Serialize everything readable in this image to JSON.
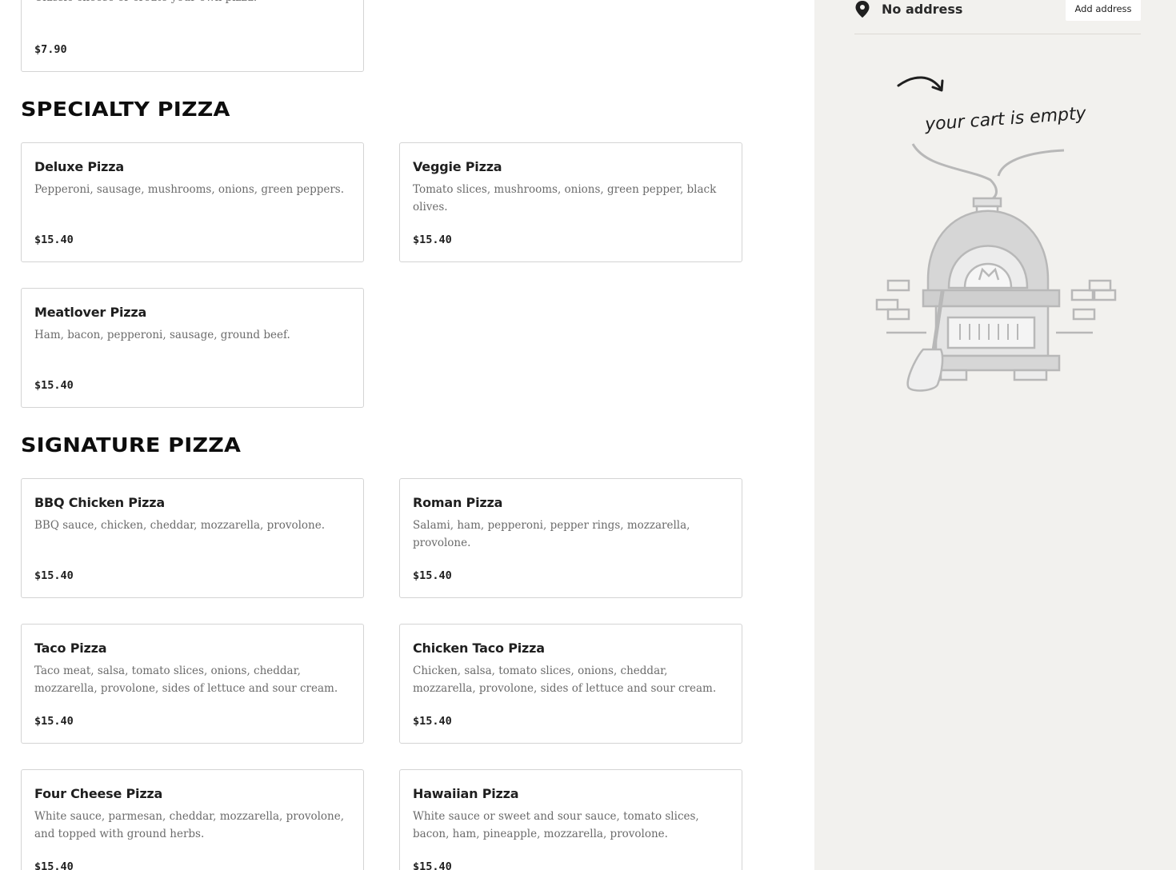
{
  "top_partial": {
    "description": "Classic cheese or create your own pizza.",
    "price": "$7.90"
  },
  "sections": [
    {
      "title": "SPECIALTY PIZZA",
      "items": [
        {
          "name": "Deluxe Pizza",
          "description": "Pepperoni, sausage, mushrooms, onions, green peppers.",
          "price": "$15.40"
        },
        {
          "name": "Veggie Pizza",
          "description": "Tomato slices, mushrooms, onions, green pepper, black olives.",
          "price": "$15.40"
        },
        {
          "name": "Meatlover Pizza",
          "description": "Ham, bacon, pepperoni, sausage, ground beef.",
          "price": "$15.40"
        }
      ]
    },
    {
      "title": "SIGNATURE PIZZA",
      "items": [
        {
          "name": "BBQ Chicken Pizza",
          "description": "BBQ sauce, chicken, cheddar, mozzarella, provolone.",
          "price": "$15.40"
        },
        {
          "name": "Roman Pizza",
          "description": "Salami, ham, pepperoni, pepper rings, mozzarella, provolone.",
          "price": "$15.40"
        },
        {
          "name": "Taco Pizza",
          "description": "Taco meat, salsa, tomato slices, onions, cheddar, mozzarella, provolone, sides of lettuce and sour cream.",
          "price": "$15.40"
        },
        {
          "name": "Chicken Taco Pizza",
          "description": "Chicken, salsa, tomato slices, onions, cheddar, mozzarella, provolone, sides of lettuce and sour cream.",
          "price": "$15.40"
        },
        {
          "name": "Four Cheese Pizza",
          "description": "White sauce, parmesan, cheddar, mozzarella, provolone, and topped with ground herbs.",
          "price": "$15.40"
        },
        {
          "name": "Hawaiian Pizza",
          "description": "White sauce or sweet and sour sauce, tomato slices, bacon, ham, pineapple, mozzarella, provolone.",
          "price": "$15.40"
        }
      ]
    }
  ],
  "sidebar": {
    "address_label": "No address",
    "add_address_button": "Add address",
    "empty_cart_text": "your cart is empty",
    "icons": {
      "location": "location-pin-icon"
    }
  },
  "colors": {
    "sidebar_bg": "#f2f1ee",
    "card_border": "#d4d4d4",
    "text_dark": "#1a1a1a",
    "text_muted": "#6b6b6b"
  }
}
